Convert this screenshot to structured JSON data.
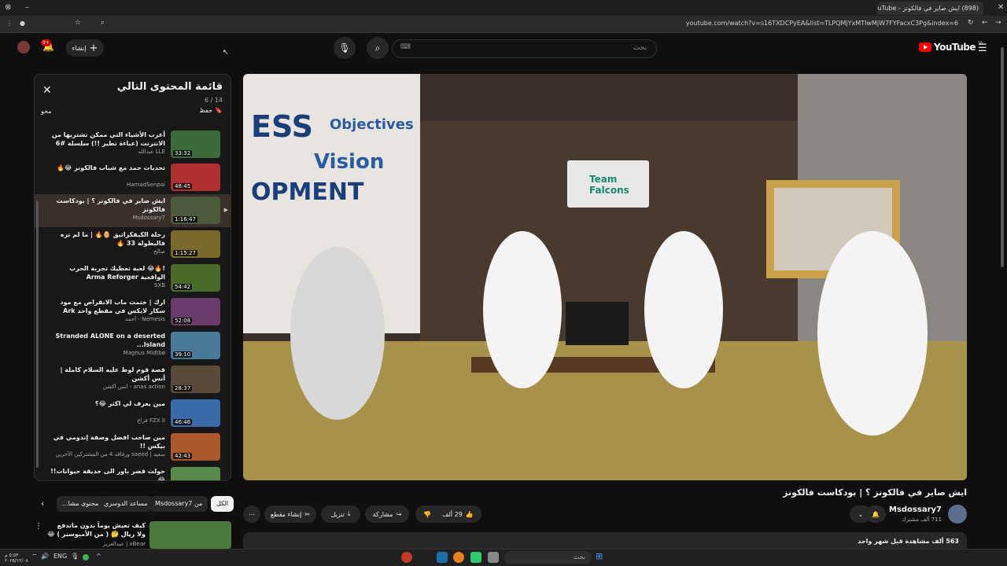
{
  "browser": {
    "tab_title": "(898) ايش صاير في فالكونز - YouTube",
    "url": "youtube.com/watch?v=s16TXDCPyEA&list=TLPQMjYxMTIwMjW7FYFacxC3Pg&index=6"
  },
  "masthead": {
    "search_placeholder": "بحث",
    "create_label": "إنشاء",
    "notif_count": "9+",
    "logo_text": "YouTube",
    "logo_region": "SA"
  },
  "playlist": {
    "title": "قائمة المحتوى التالي",
    "count": "6 / 14",
    "save_label": "حفظ",
    "loop_label": "محو",
    "items": [
      {
        "title": "أغرب الأشياء التي ممكن تشتريها من الانترنت (عباءة تطير !!) سلسلة #6",
        "channel": "LLE عبدالله",
        "duration": "33:32",
        "color": "#3b6b3a"
      },
      {
        "title": "تحديات حمد مع شباب فالكونز 😂🔥",
        "channel": "HamadSenpai",
        "duration": "48:45",
        "color": "#b03030"
      },
      {
        "title": "ايش صاير في فالكونز ؟ | بودكاست فالكونز",
        "channel": "Msdossary7",
        "duration": "1:16:47",
        "color": "#4a5a3a"
      },
      {
        "title": "رحلة الكيفكراتيق 🥚🔥 | ما لم تره فالبطولة 33 🔥",
        "channel": "صالح",
        "duration": "1:15:27",
        "color": "#7a6a2a"
      },
      {
        "title": "!🔥😂 لعبة تعطيك تجربة الحرب الواقعية Arma Reforger",
        "channel": "SXB",
        "duration": "54:42",
        "color": "#4a6a2a"
      },
      {
        "title": "ارك | ختمت ماب الانقراض مع مود سكار لايكس في مقطع واحد Ark Survival...",
        "channel": "Nemesis - أحمد",
        "duration": "52:08",
        "color": "#6a3a6a"
      },
      {
        "title": "Stranded ALONE on a deserted Island...",
        "channel": "Magnus Midtbø",
        "duration": "39:10",
        "color": "#4a7a9a"
      },
      {
        "title": "قصة قوم لوط عليه السلام كاملة | أنس أكشن",
        "channel": "anas action - أنس أكشن",
        "duration": "28:37",
        "color": "#5a4a3a"
      },
      {
        "title": "مين يعرف لي اكثر 😂؟",
        "channel": "FZX II فزاع",
        "duration": "46:46",
        "color": "#3a6aaa"
      },
      {
        "title": "مين صاحب افضل وصفة إندومي في بيكس !!",
        "channel": "سعيد | saeed ورفاقه 4 من المشتركين الآخرين",
        "duration": "42:43",
        "color": "#aa5a2a"
      },
      {
        "title": "حولت قصر باور الى حديقة حيوانات!! 😂",
        "channel": "",
        "duration": "32:17",
        "color": "#5a8a4a"
      }
    ]
  },
  "video": {
    "title": "ايش صاير في فالكونز ؟ | بودكاست فالكونز",
    "channel_name": "Msdossary7",
    "subscribers": "711 ألف مشترك",
    "likes": "29 ألف",
    "share_label": "مشاركة",
    "download_label": "تنزيل",
    "clip_label": "إنشاء مقطع",
    "views_line": "563 ألف مشاهدة  قبل شهر واحد",
    "sign_text": "Team Falcons"
  },
  "chips": [
    "الكل",
    "من Msdossary7",
    "مساعد الدوسري",
    "محتوى مشا..."
  ],
  "next_rec": {
    "title": "كيف تعيش يوماً بدون ماتدفع ولا ريال 🤔 ( من الأمبوسنر ) 😂",
    "channel": "xBear | عبدالعزيز"
  },
  "taskbar": {
    "lang": "ENG",
    "time": "٥:٥٣ م",
    "date": "٢٠٢٥/١٢/٠٨",
    "search": "بحث"
  }
}
